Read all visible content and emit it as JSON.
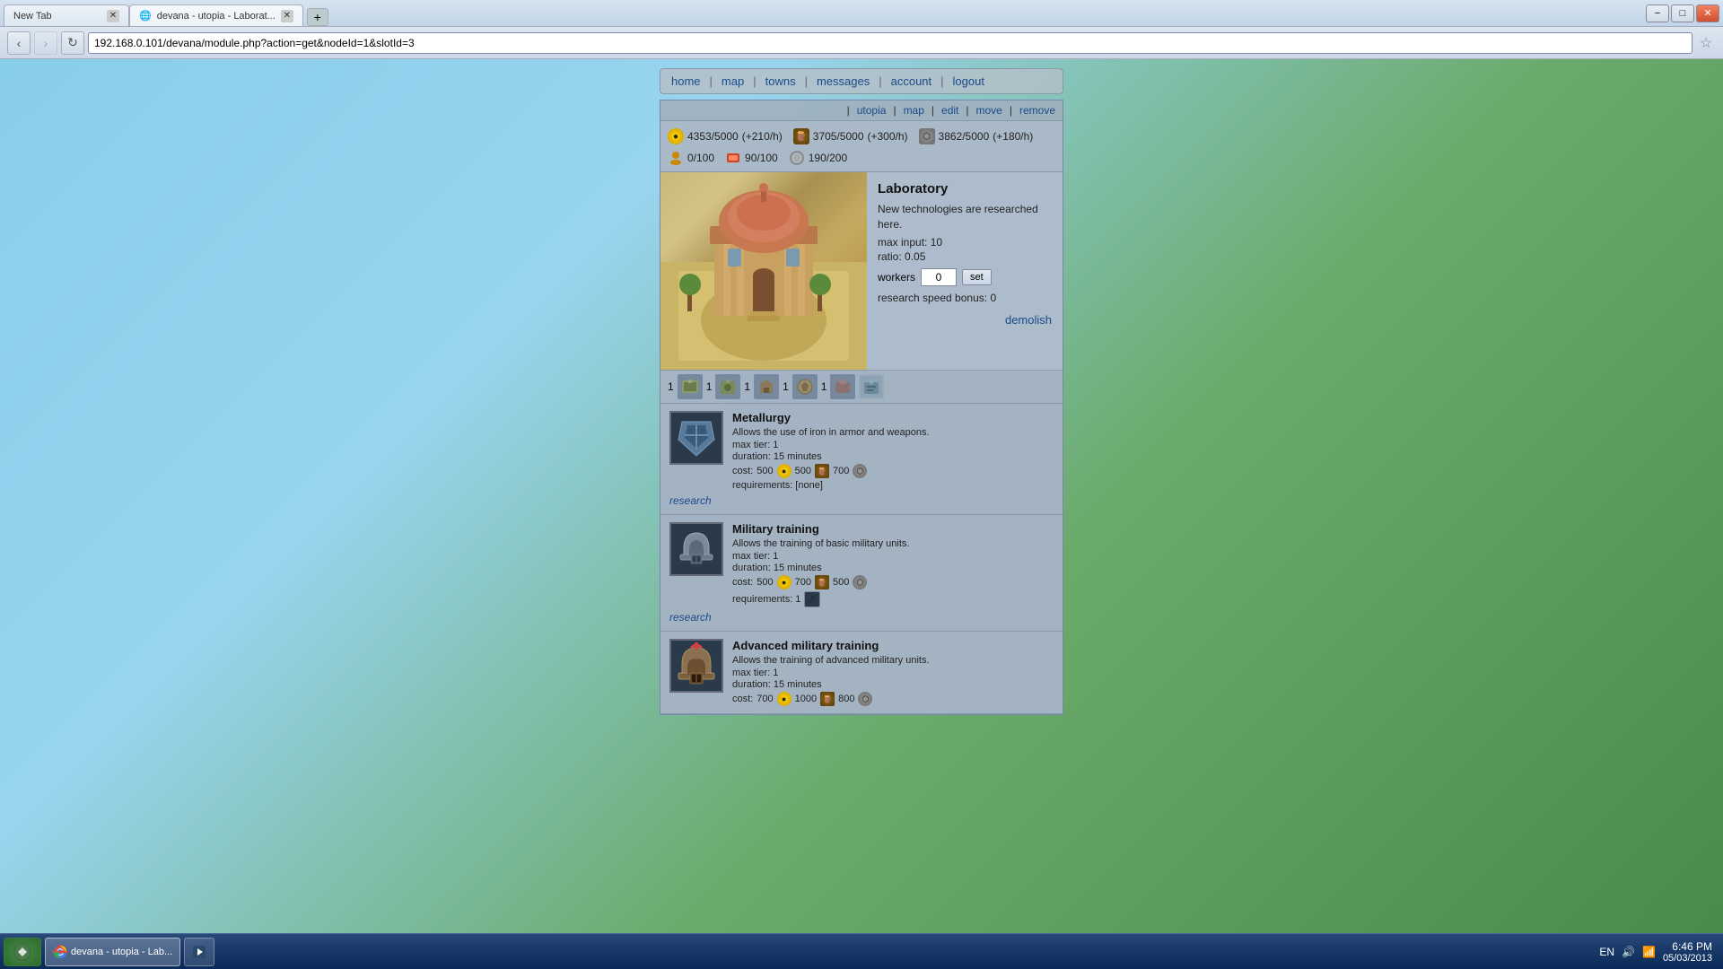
{
  "browser": {
    "tabs": [
      {
        "label": "New Tab",
        "active": false
      },
      {
        "label": "devana - utopia - Laborat...",
        "active": true
      }
    ],
    "address": "192.168.0.101/devana/module.php?action=get&nodeId=1&slotId=3",
    "back_btn": "‹",
    "forward_btn": "›",
    "refresh_btn": "↻",
    "star_icon": "★"
  },
  "nav": {
    "separator": "|",
    "items": [
      {
        "label": "utopia",
        "href": "#"
      },
      {
        "label": "map",
        "href": "#"
      },
      {
        "label": "edit",
        "href": "#"
      },
      {
        "label": "move",
        "href": "#"
      },
      {
        "label": "remove",
        "href": "#"
      }
    ]
  },
  "top_nav": {
    "items": [
      {
        "label": "home"
      },
      {
        "label": "map"
      },
      {
        "label": "towns"
      },
      {
        "label": "messages"
      },
      {
        "label": "account"
      },
      {
        "label": "logout"
      }
    ]
  },
  "resources": {
    "gold": {
      "value": "4353/5000",
      "rate": "(+210/h)"
    },
    "wood": {
      "value": "3705/5000",
      "rate": "(+300/h)"
    },
    "stone": {
      "value": "3862/5000",
      "rate": "(+180/h)"
    },
    "stat1": {
      "value": "0/100"
    },
    "stat2": {
      "value": "90/100"
    },
    "stat3": {
      "value": "190/200"
    }
  },
  "building": {
    "title": "Laboratory",
    "description": "New technologies are researched here.",
    "max_input_label": "max input:",
    "max_input_value": "10",
    "ratio_label": "ratio:",
    "ratio_value": "0.05",
    "workers_label": "workers",
    "workers_value": "0",
    "set_label": "set",
    "research_speed_label": "research speed bonus:",
    "research_speed_value": "0",
    "demolish_label": "demolish"
  },
  "slots": [
    {
      "number": "1",
      "active": false
    },
    {
      "number": "1",
      "active": false
    },
    {
      "number": "1",
      "active": false
    },
    {
      "number": "1",
      "active": false
    },
    {
      "number": "1",
      "active": false
    },
    {
      "number": "",
      "active": true
    }
  ],
  "research_items": [
    {
      "title": "Metallurgy",
      "description": "Allows the use of iron in armor and weapons.",
      "max_tier": "max tier: 1",
      "duration": "duration: 15 minutes",
      "cost_gold": "500",
      "cost_wood": "500",
      "cost_stone": "700",
      "requirements": "requirements: [none]",
      "action": "research"
    },
    {
      "title": "Military training",
      "description": "Allows the training of basic military units.",
      "max_tier": "max tier: 1",
      "duration": "duration: 15 minutes",
      "cost_gold": "500",
      "cost_wood": "700",
      "cost_stone": "500",
      "requirements": "requirements: 1",
      "action": "research"
    },
    {
      "title": "Advanced military training",
      "description": "Allows the training of advanced military units.",
      "max_tier": "max tier: 1",
      "duration": "duration: 15 minutes",
      "cost_gold": "700",
      "cost_wood": "1000",
      "cost_stone": "800",
      "requirements": "",
      "action": "research"
    }
  ],
  "taskbar": {
    "time": "6:46 PM",
    "date": "05/03/2013",
    "lang": "EN",
    "apps": [
      {
        "label": "Windows",
        "icon": "⊞"
      },
      {
        "label": "Chrome",
        "icon": "●"
      },
      {
        "label": "Media",
        "icon": "♪"
      }
    ]
  }
}
